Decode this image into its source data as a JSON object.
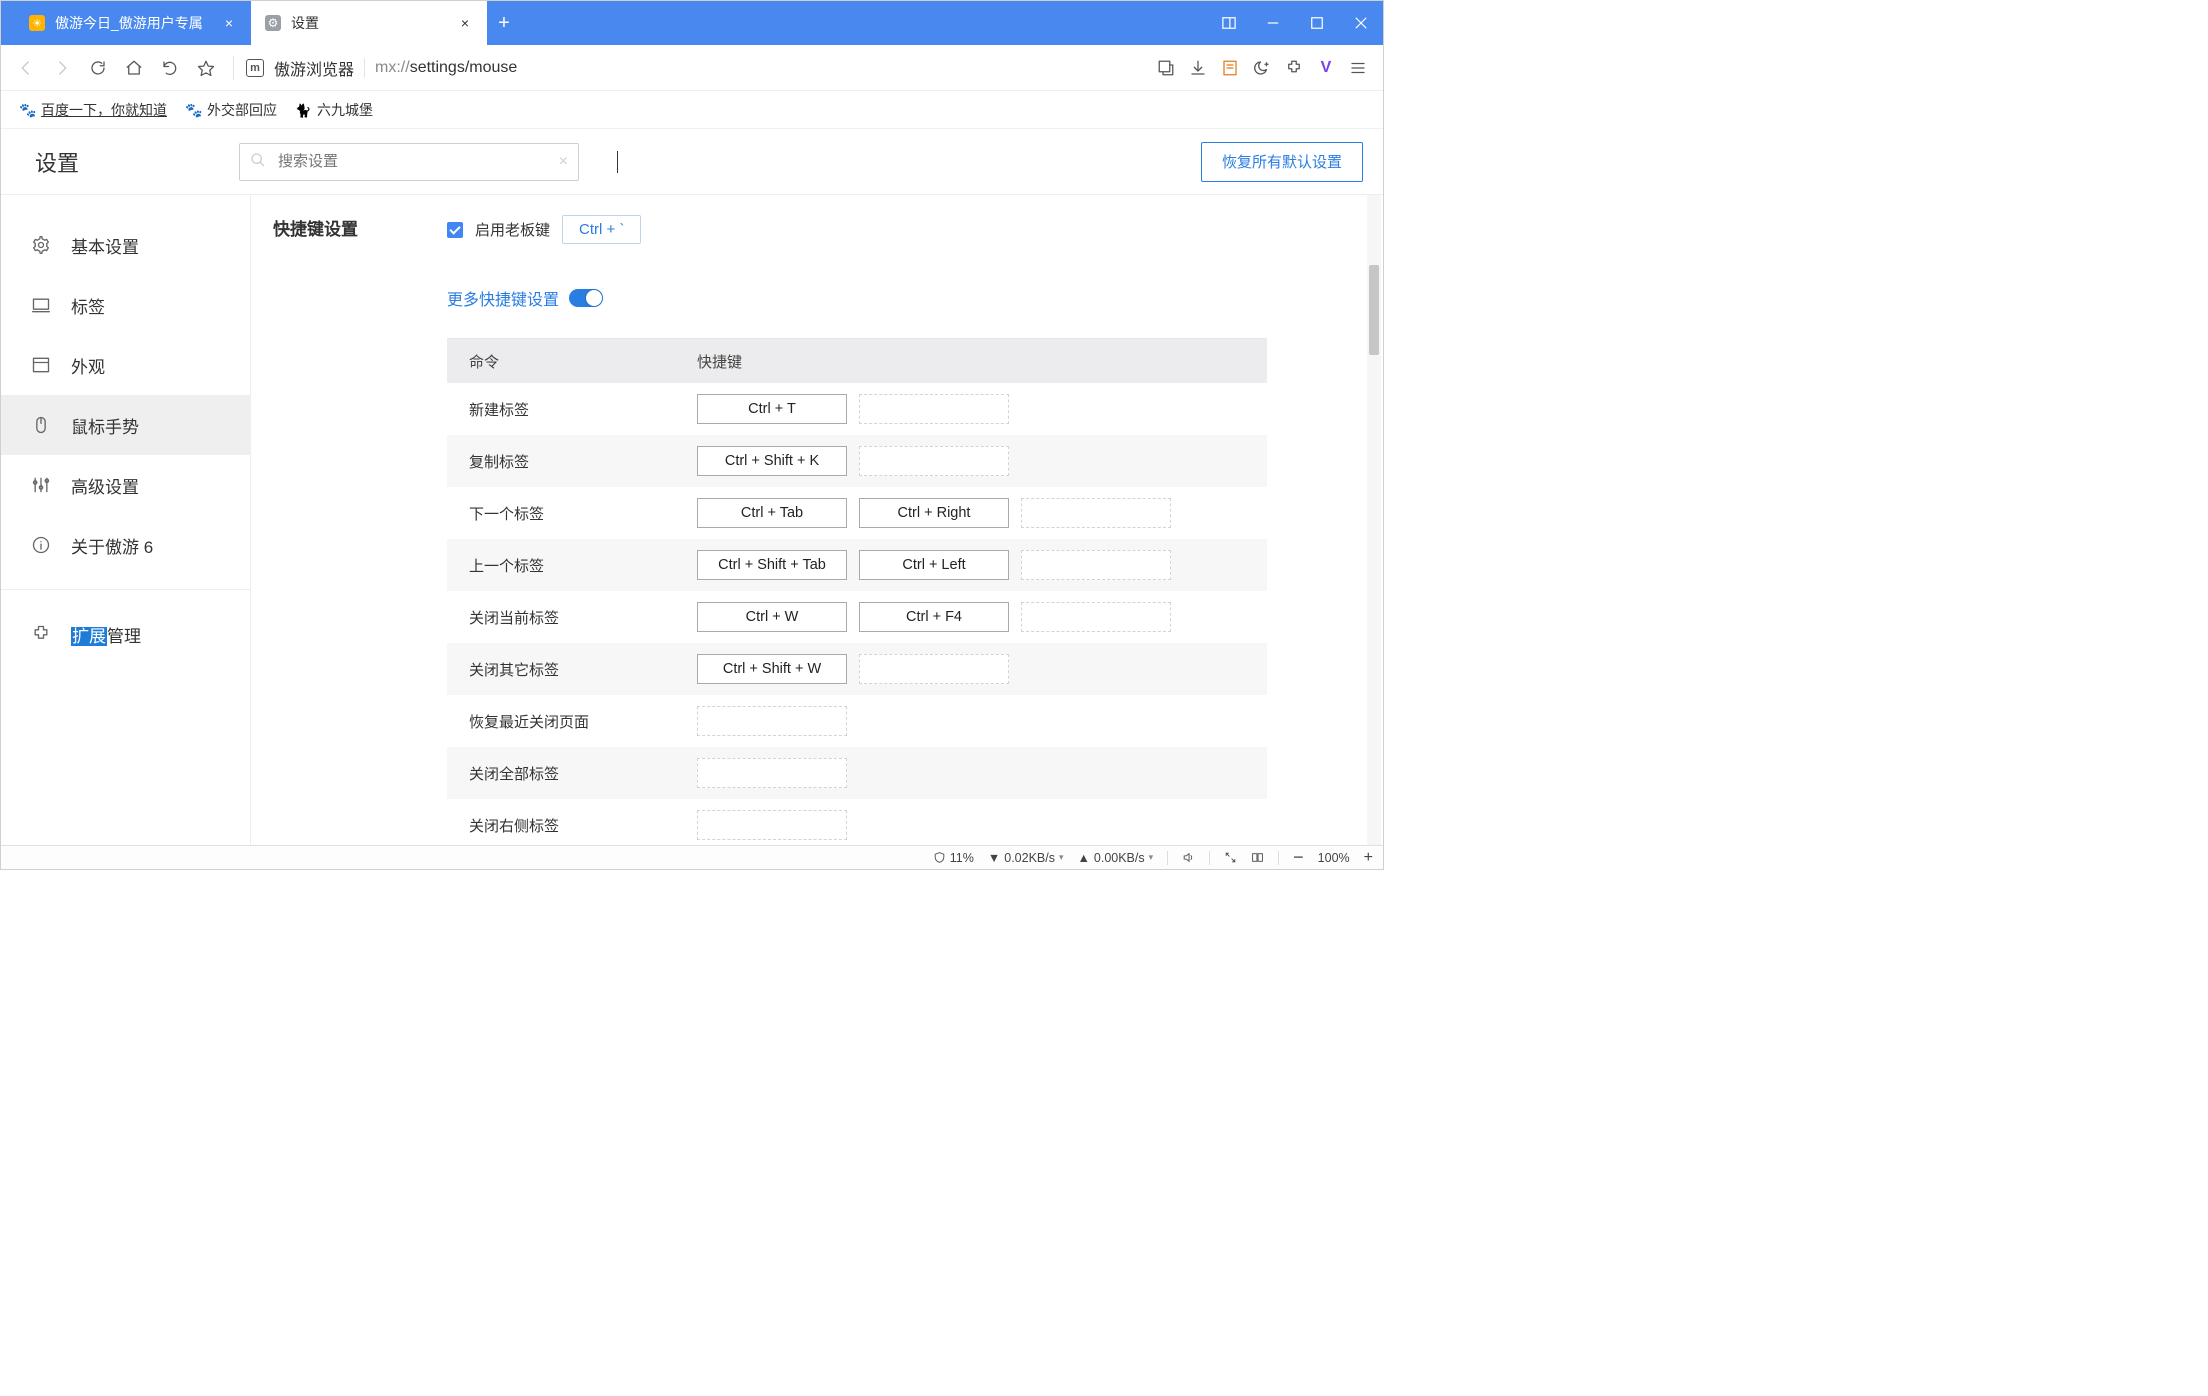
{
  "tabs": [
    {
      "title": "傲游今日_傲游用户专属"
    },
    {
      "title": "设置"
    }
  ],
  "address": {
    "browser_name": "傲游浏览器",
    "proto": "mx://",
    "path": "settings/mouse"
  },
  "bookmarks": [
    {
      "label": "百度一下，你就知道"
    },
    {
      "label": "外交部回应"
    },
    {
      "label": "六九城堡"
    }
  ],
  "settings": {
    "title": "设置",
    "search_placeholder": "搜索设置",
    "restore_defaults": "恢复所有默认设置"
  },
  "sidebar": [
    {
      "id": "general",
      "label": "基本设置"
    },
    {
      "id": "tabs",
      "label": "标签"
    },
    {
      "id": "appearance",
      "label": "外观"
    },
    {
      "id": "mouse",
      "label": "鼠标手势",
      "active": true
    },
    {
      "id": "advanced",
      "label": "高级设置"
    },
    {
      "id": "about",
      "label": "关于傲游 6"
    },
    {
      "id": "ext",
      "label_pre": "扩展",
      "label_post": "管理"
    }
  ],
  "shortcut_section": {
    "title": "快捷键设置",
    "enable_boss_label": "启用老板键",
    "boss_key": "Ctrl + `",
    "more_shortcuts": "更多快捷键设置",
    "header_cmd": "命令",
    "header_key": "快捷键",
    "rows": [
      {
        "cmd": "新建标签",
        "k1": "Ctrl + T",
        "k2": ""
      },
      {
        "cmd": "复制标签",
        "k1": "Ctrl + Shift + K",
        "k2": ""
      },
      {
        "cmd": "下一个标签",
        "k1": "Ctrl + Tab",
        "k2": "Ctrl + Right",
        "k3": ""
      },
      {
        "cmd": "上一个标签",
        "k1": "Ctrl + Shift + Tab",
        "k2": "Ctrl + Left",
        "k3": ""
      },
      {
        "cmd": "关闭当前标签",
        "k1": "Ctrl + W",
        "k2": "Ctrl + F4",
        "k3": ""
      },
      {
        "cmd": "关闭其它标签",
        "k1": "Ctrl + Shift + W",
        "k2": ""
      },
      {
        "cmd": "恢复最近关闭页面",
        "k1": ""
      },
      {
        "cmd": "关闭全部标签",
        "k1": ""
      },
      {
        "cmd": "关闭右侧标签",
        "k1": ""
      }
    ]
  },
  "statusbar": {
    "cpu": "11%",
    "down": "0.02KB/s",
    "up": "0.00KB/s",
    "zoom": "100%"
  }
}
